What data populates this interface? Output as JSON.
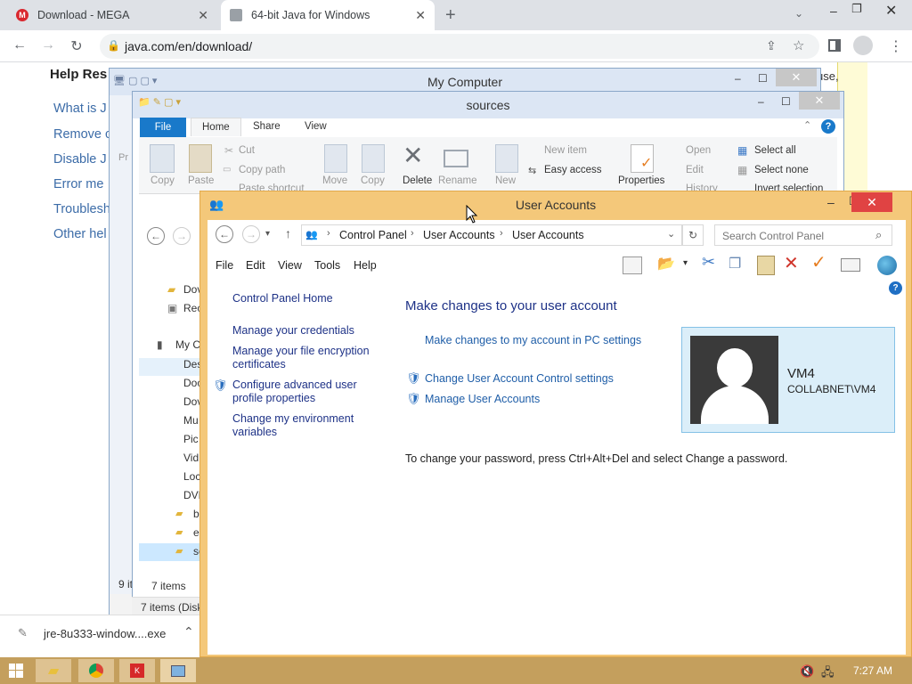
{
  "browser": {
    "tabs": [
      {
        "title": "Download - MEGA"
      },
      {
        "title": "64-bit Java for Windows"
      }
    ],
    "url": "java.com/en/download/"
  },
  "java_page": {
    "help_heading": "Help Res",
    "links": [
      "What is J",
      "Remove c",
      "Disable J",
      "Error me",
      "Troublesh",
      "Other hel"
    ],
    "right_fragment": "use,"
  },
  "download_bar": {
    "filename": "jre-8u333-window....exe"
  },
  "mycomputer": {
    "title": "My Computer",
    "items": [
      "Des",
      "Doc",
      "Dov",
      "Mu",
      "Pic",
      "Vid",
      "Loc",
      "DVD",
      "b",
      "e",
      "so"
    ],
    "heading": "My C",
    "status": "9 it"
  },
  "sources": {
    "title": "sources",
    "ribbon_tabs": [
      "File",
      "Home",
      "Share",
      "View"
    ],
    "ribbon": {
      "copy": "Copy",
      "paste": "Paste",
      "cut": "Cut",
      "copy_path": "Copy path",
      "paste_shortcut": "Paste shortcut",
      "move": "Move",
      "copy2": "Copy",
      "delete": "Delete",
      "rename": "Rename",
      "new": "New",
      "new_item": "New item",
      "easy_access": "Easy access",
      "properties": "Properties",
      "open": "Open",
      "edit": "Edit",
      "history": "History",
      "select_all": "Select all",
      "select_none": "Select none",
      "invert": "Invert selection"
    },
    "side": [
      "Dov",
      "Rec"
    ],
    "status_items": "7 items",
    "status_bottom": "7 items (Disk"
  },
  "user_accounts": {
    "title": "User Accounts",
    "breadcrumb": [
      "Control Panel",
      "User Accounts",
      "User Accounts"
    ],
    "search_placeholder": "Search Control Panel",
    "menu": [
      "File",
      "Edit",
      "View",
      "Tools",
      "Help"
    ],
    "left": {
      "home": "Control Panel Home",
      "credentials": "Manage your credentials",
      "encryption": "Manage your file encryption certificates",
      "advanced": "Configure advanced user profile properties",
      "environment": "Change my environment variables"
    },
    "main": {
      "heading": "Make changes to your user account",
      "pc_settings": "Make changes to my account in PC settings",
      "uac": "Change User Account Control settings",
      "manage": "Manage User Accounts",
      "password_note": "To change your password, press Ctrl+Alt+Del and select Change a password."
    },
    "account": {
      "name": "VM4",
      "domain": "COLLABNET\\VM4"
    }
  },
  "taskbar": {
    "time": "7:27 AM"
  },
  "colors": {
    "accent_link": "#1f5ea8",
    "ua_frame": "#f4c87a",
    "taskbar": "#c49f5d",
    "close_red": "#e04343"
  }
}
